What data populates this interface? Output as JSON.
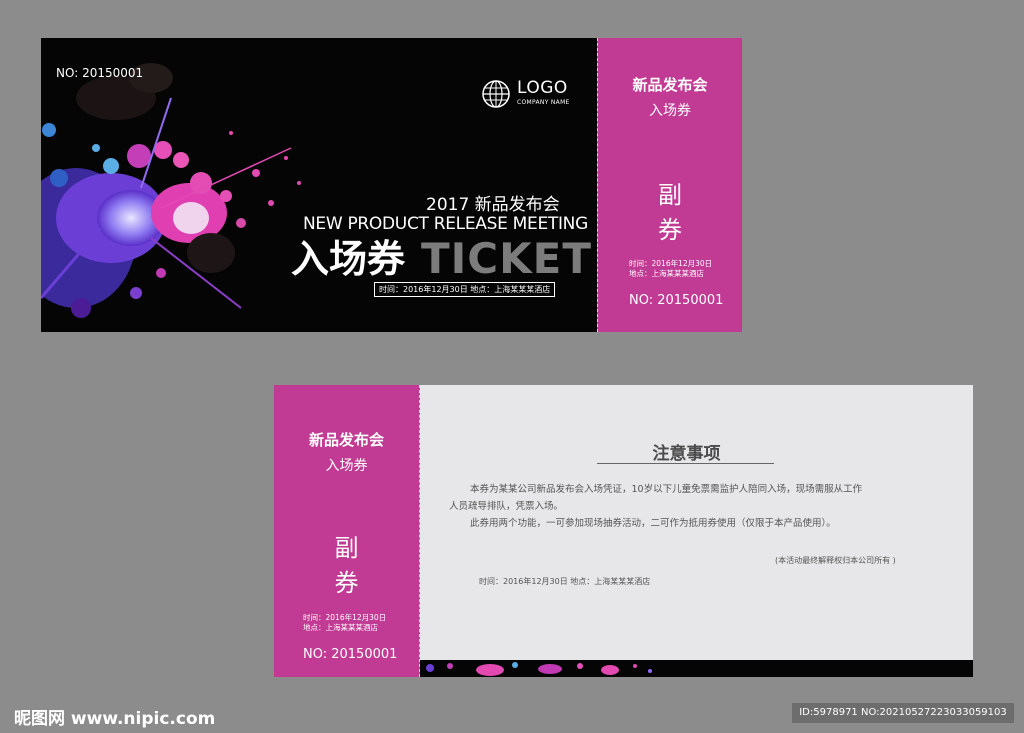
{
  "front": {
    "number": "NO: 20150001",
    "logo": {
      "text": "LOGO",
      "subtext": "COMPANY NAME",
      "icon": "globe-icon"
    },
    "year_title": "2017 新品发布会",
    "english_title": "NEW PRODUCT RELEASE MEETING",
    "cn_ticket": "入场券",
    "en_ticket": "TICKET",
    "info_line": "时间：2016年12月30日    地点：上海某某某酒店"
  },
  "stub": {
    "title": "新品发布会",
    "subtitle": "入场券",
    "char1": "副",
    "char2": "券",
    "time": "时间：2016年12月30日",
    "location": "地点：上海某某某酒店",
    "number": "NO: 20150001"
  },
  "back": {
    "notice_title": "注意事项",
    "para1_line1": "本券为某某公司新品发布会入场凭证，10岁以下儿童免票需监护人陪同入场，现场需服从工作",
    "para1_line2": "人员疏导排队，凭票入场。",
    "para2": "此券用两个功能，一可参加现场抽券活动，二可作为抵用券使用（仅限于本产品使用）。",
    "final_note": "(本活动最终解释权归本公司所有 )",
    "info_line": "时间：2016年12月30日    地点：上海某某某酒店"
  },
  "watermark": {
    "left": "昵图网 www.nipic.com",
    "right": "ID:5978971 NO:20210527223033059103"
  },
  "colors": {
    "background": "#8c8c8c",
    "ticket_black": "#050505",
    "accent_magenta": "#c13a93",
    "back_panel": "#e7e6e8"
  }
}
